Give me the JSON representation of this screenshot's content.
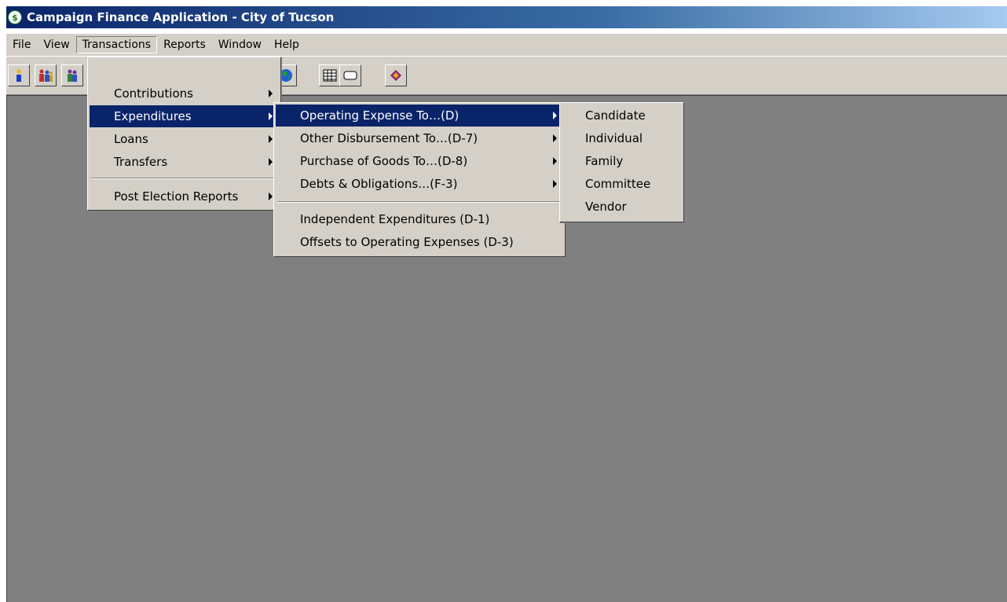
{
  "window": {
    "title": "Campaign Finance Application - City of Tucson",
    "icon": "dollar-seal-icon"
  },
  "menubar": [
    "File",
    "View",
    "Transactions",
    "Reports",
    "Window",
    "Help"
  ],
  "toolbar": {
    "icons": [
      "person-icon",
      "group-icon",
      "people-icon",
      "globe-icon",
      "table-icon",
      "rectangle-icon",
      "book-icon"
    ]
  },
  "transactions_menu": {
    "contributions": "Contributions",
    "expenditures": "Expenditures",
    "loans": "Loans",
    "transfers": "Transfers",
    "post_election": "Post Election Reports"
  },
  "expenditures_menu": {
    "operating": "Operating Expense To…(D)",
    "other": "Other Disbursement To…(D-7)",
    "purchase": "Purchase of Goods To…(D-8)",
    "debts": "Debts & Obligations…(F-3)",
    "independent": "Independent Expenditures (D-1)",
    "offsets": "Offsets to Operating Expenses (D-3)"
  },
  "operating_menu": [
    "Candidate",
    "Individual",
    "Family",
    "Committee",
    "Vendor"
  ],
  "colors": {
    "highlight": "#0a246a",
    "face": "#d4d0c8",
    "workspace": "#808080"
  }
}
